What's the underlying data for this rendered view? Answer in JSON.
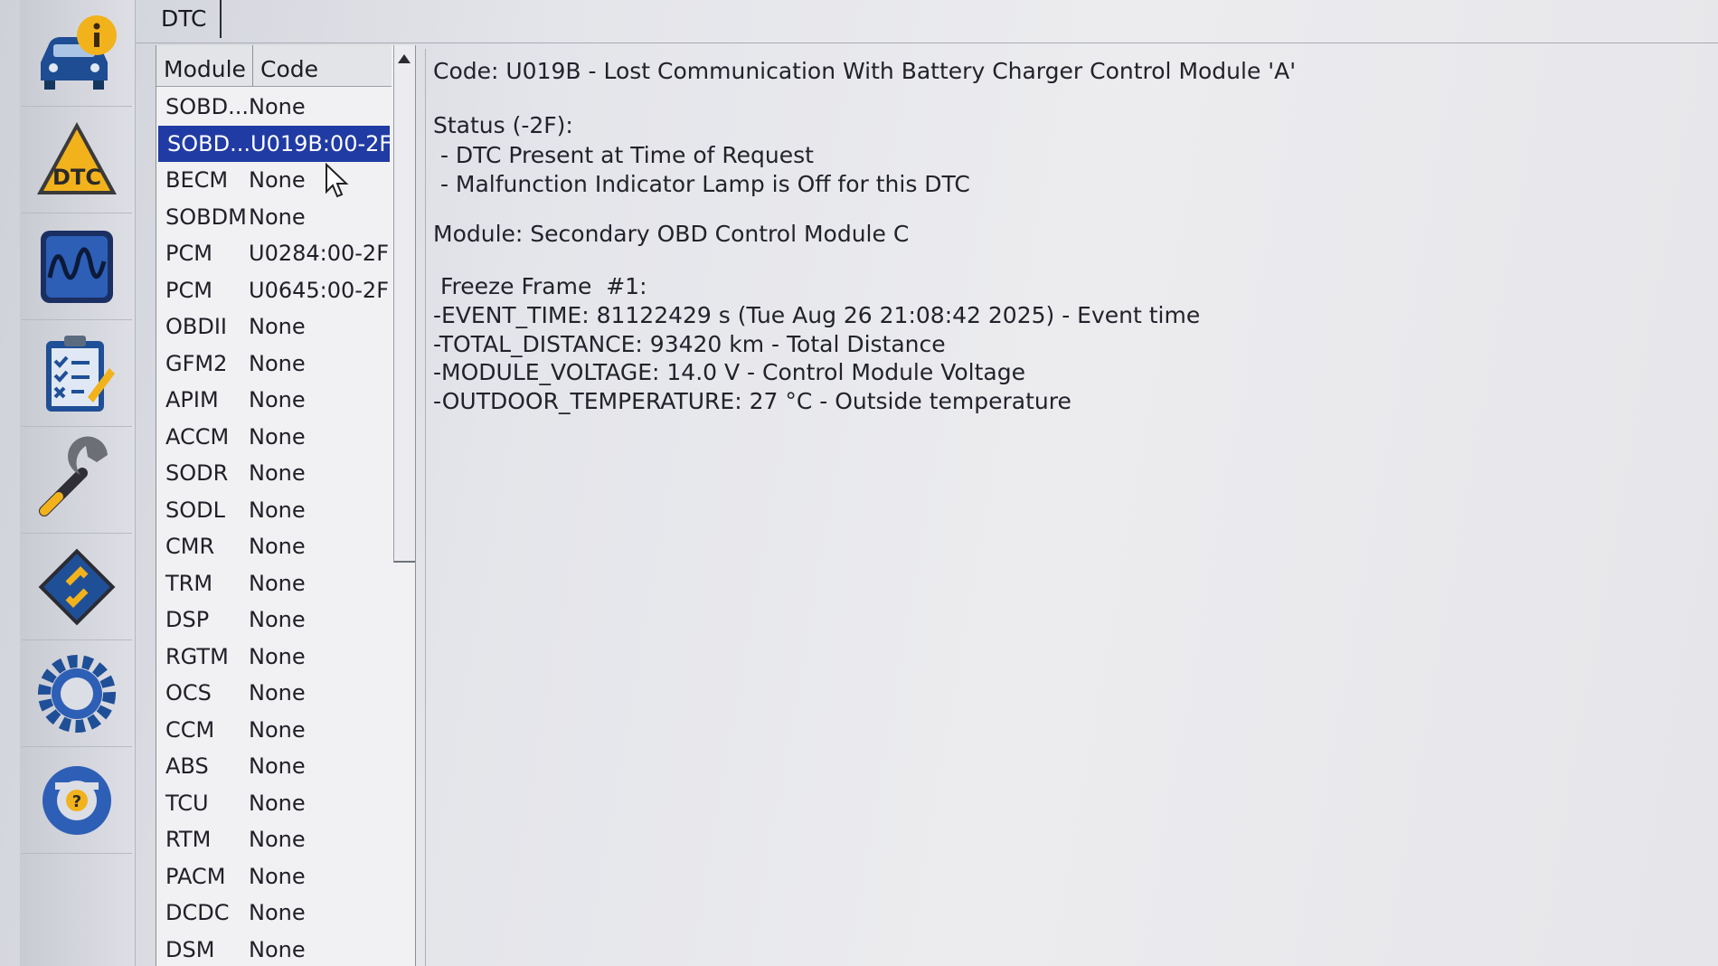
{
  "tab": {
    "label": "DTC"
  },
  "toolbar": {
    "items": [
      {
        "name": "vehicle-info-icon"
      },
      {
        "name": "dtc-warning-icon",
        "label": "DTC"
      },
      {
        "name": "oscilloscope-icon"
      },
      {
        "name": "checklist-icon"
      },
      {
        "name": "wrench-icon"
      },
      {
        "name": "module-chip-icon"
      },
      {
        "name": "gear-icon"
      },
      {
        "name": "help-icon",
        "label": "?"
      }
    ]
  },
  "dtc_list": {
    "columns": [
      "Module",
      "Code"
    ],
    "selected_index": 1,
    "rows": [
      {
        "module": "SOBD...",
        "code": "None"
      },
      {
        "module": "SOBD...",
        "code": "U019B:00-2F"
      },
      {
        "module": "BECM",
        "code": "None"
      },
      {
        "module": "SOBDM",
        "code": "None"
      },
      {
        "module": "PCM",
        "code": "U0284:00-2F"
      },
      {
        "module": "PCM",
        "code": "U0645:00-2F"
      },
      {
        "module": "OBDII",
        "code": "None"
      },
      {
        "module": "GFM2",
        "code": "None"
      },
      {
        "module": "APIM",
        "code": "None"
      },
      {
        "module": "ACCM",
        "code": "None"
      },
      {
        "module": "SODR",
        "code": "None"
      },
      {
        "module": "SODL",
        "code": "None"
      },
      {
        "module": "CMR",
        "code": "None"
      },
      {
        "module": "TRM",
        "code": "None"
      },
      {
        "module": "DSP",
        "code": "None"
      },
      {
        "module": "RGTM",
        "code": "None"
      },
      {
        "module": "OCS",
        "code": "None"
      },
      {
        "module": "CCM",
        "code": "None"
      },
      {
        "module": "ABS",
        "code": "None"
      },
      {
        "module": "TCU",
        "code": "None"
      },
      {
        "module": "RTM",
        "code": "None"
      },
      {
        "module": "PACM",
        "code": "None"
      },
      {
        "module": "DCDC",
        "code": "None"
      },
      {
        "module": "DSM",
        "code": "None"
      }
    ]
  },
  "detail": {
    "code_line": "Code: U019B - Lost Communication With Battery Charger Control Module 'A'",
    "status_title": "Status (-2F):",
    "status_items": [
      " - DTC Present at Time of Request",
      " - Malfunction Indicator Lamp is Off for this DTC"
    ],
    "module_line": "Module: Secondary OBD Control Module C",
    "freeze_title": " Freeze Frame  #1:",
    "freeze_items": [
      "-EVENT_TIME: 81122429 s (Tue Aug 26 21:08:42 2025) - Event time",
      "-TOTAL_DISTANCE: 93420 km - Total Distance",
      "-MODULE_VOLTAGE: 14.0 V - Control Module Voltage",
      "-OUTDOOR_TEMPERATURE: 27 °C - Outside temperature"
    ]
  },
  "colors": {
    "selection": "#213ba4",
    "accent_blue": "#1f4f96",
    "warning_yellow": "#f2b21c"
  }
}
